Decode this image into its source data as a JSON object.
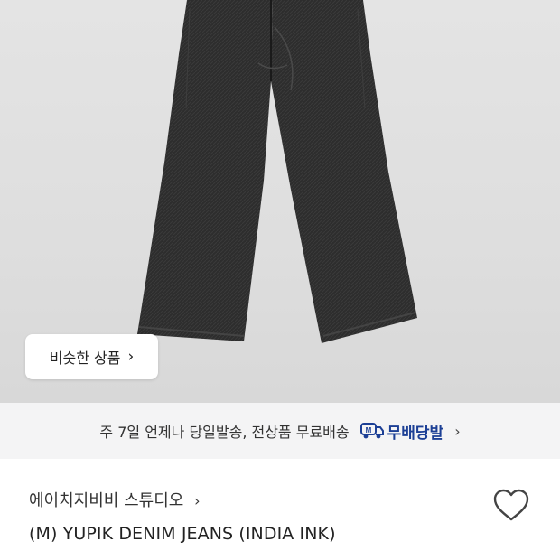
{
  "product_image": {
    "alt_icon": "jeans-image",
    "similar_button_label": "비슷한 상품",
    "similar_button_icon": "chevron-right-icon"
  },
  "delivery_banner": {
    "text": "주 7일 언제나 당일발송, 전상품 무료배송",
    "badge_icon": "delivery-truck-icon",
    "badge_label": "무배당발",
    "chevron_icon": "chevron-right-icon"
  },
  "product": {
    "brand": "에이치지비비 스튜디오",
    "title": "(M) YUPIK DENIM JEANS (INDIA INK)",
    "wishlist_icon": "heart-icon"
  },
  "colors": {
    "badge_blue": "#1c3f95",
    "banner_bg": "#f4f4f5"
  }
}
